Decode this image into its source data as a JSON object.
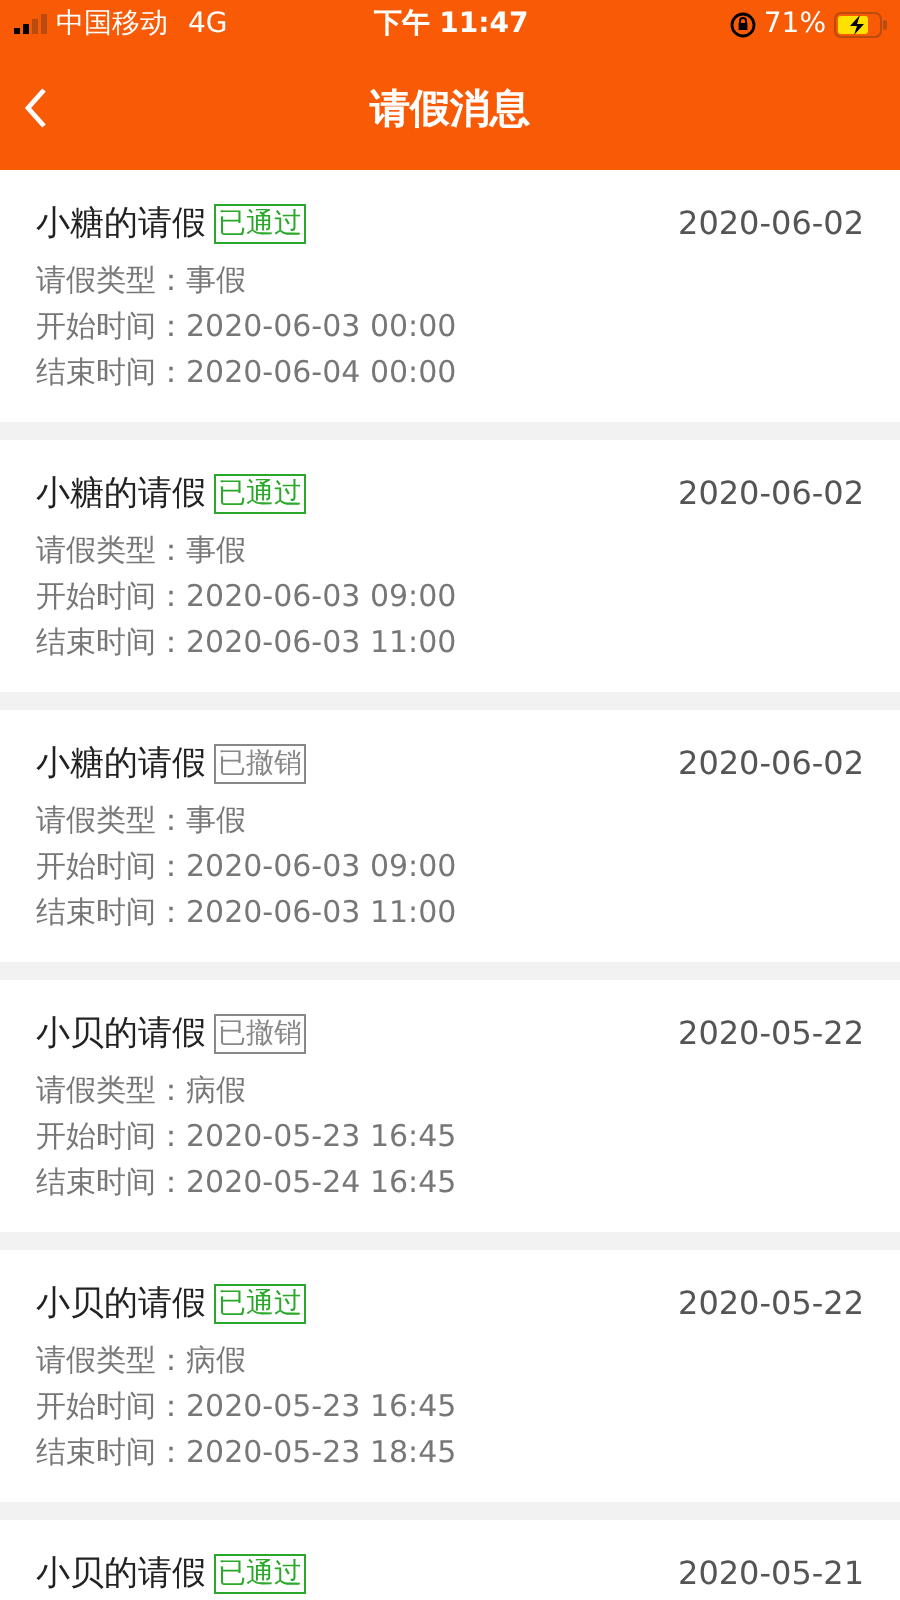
{
  "status_bar": {
    "carrier": "中国移动",
    "network": "4G",
    "time": "下午 11:47",
    "battery": "71%",
    "charging": true
  },
  "nav": {
    "title": "请假消息"
  },
  "leaves": [
    {
      "title": "小糖的请假",
      "status": {
        "kind": "approved",
        "label": "已通过"
      },
      "date": "2020-06-02",
      "details": [
        "请假类型：事假",
        "开始时间：2020-06-03 00:00",
        "结束时间：2020-06-04 00:00"
      ]
    },
    {
      "title": "小糖的请假",
      "status": {
        "kind": "approved",
        "label": "已通过"
      },
      "date": "2020-06-02",
      "details": [
        "请假类型：事假",
        "开始时间：2020-06-03 09:00",
        "结束时间：2020-06-03 11:00"
      ]
    },
    {
      "title": "小糖的请假",
      "status": {
        "kind": "revoked",
        "label": "已撤销"
      },
      "date": "2020-06-02",
      "details": [
        "请假类型：事假",
        "开始时间：2020-06-03 09:00",
        "结束时间：2020-06-03 11:00"
      ]
    },
    {
      "title": "小贝的请假",
      "status": {
        "kind": "revoked",
        "label": "已撤销"
      },
      "date": "2020-05-22",
      "details": [
        "请假类型：病假",
        "开始时间：2020-05-23 16:45",
        "结束时间：2020-05-24 16:45"
      ]
    },
    {
      "title": "小贝的请假",
      "status": {
        "kind": "approved",
        "label": "已通过"
      },
      "date": "2020-05-22",
      "details": [
        "请假类型：病假",
        "开始时间：2020-05-23 16:45",
        "结束时间：2020-05-23 18:45"
      ]
    },
    {
      "title": "小贝的请假",
      "status": {
        "kind": "approved",
        "label": "已通过"
      },
      "date": "2020-05-21"
    }
  ]
}
